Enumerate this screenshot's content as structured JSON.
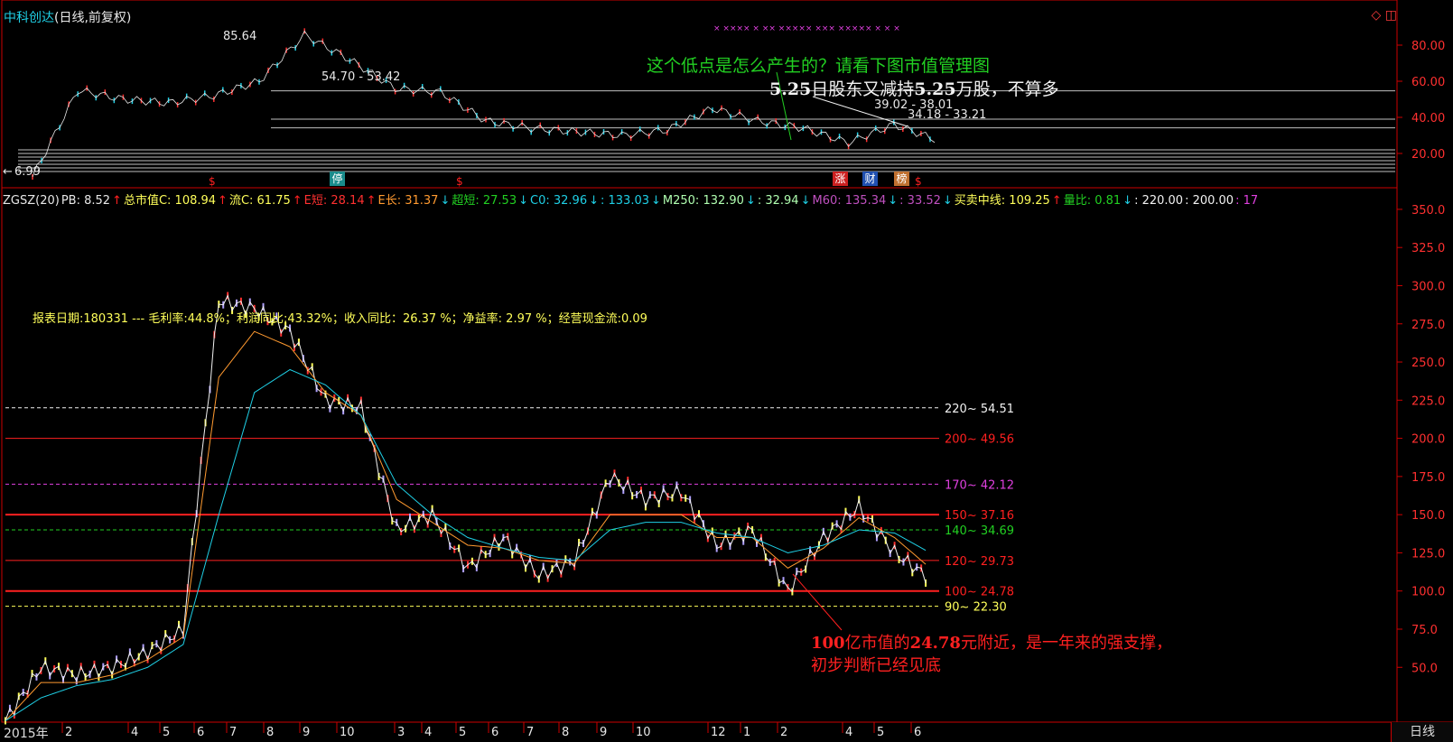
{
  "header": {
    "stock_name": "中科创达",
    "suffix": "(日线,前复权)",
    "icons": [
      "diamond-icon",
      "window-icon"
    ]
  },
  "colors": {
    "border": "#cc0000",
    "cyan": "#1fd0e6",
    "yellow": "#ffff5a",
    "green": "#22d022",
    "red": "#ff2020",
    "magenta": "#e040e0",
    "white": "#f2f2f2"
  },
  "upper_panel_labels": {
    "peak": "85.64",
    "range_left": "54.70 - 53.42",
    "range_mid": "39.02 - 38.01",
    "range_right": "34.18 - 33.21",
    "low": "6.99",
    "low_arrow": "←"
  },
  "annotations": {
    "green_question": "这个低点是怎么产生的？请看下图市值管理图",
    "white_note_prefix": "5.25",
    "white_note_mid": "日股东又减持",
    "white_note_bold": "5.25",
    "white_note_suffix": "万股，不算多",
    "red_note_line1_prefix": "100",
    "red_note_line1_mid": "亿市值的",
    "red_note_line1_bold": "24.78",
    "red_note_line1_suffix": "元附近，是一年来的强支撑，",
    "red_note_line2": "初步判断已经见底"
  },
  "badges": [
    {
      "label": "停",
      "bg": "#1a8c8c"
    },
    {
      "label": "涨",
      "bg": "#cc2020"
    },
    {
      "label": "财",
      "bg": "#2050b0"
    },
    {
      "label": "榜",
      "bg": "#c07030"
    }
  ],
  "s_markers": [
    "$",
    "$",
    "$"
  ],
  "indicator_row": [
    {
      "text": "ZGSZ(20)",
      "color": "#e8e8e8"
    },
    {
      "text": "PB: 8.52",
      "color": "#e8e8e8"
    },
    {
      "text": "↑",
      "color": "#ff2020"
    },
    {
      "text": "总市值C: 108.94",
      "color": "#ffff5a"
    },
    {
      "text": "↑",
      "color": "#ff2020"
    },
    {
      "text": "流C: 61.75",
      "color": "#ffff5a"
    },
    {
      "text": "↑",
      "color": "#ff2020"
    },
    {
      "text": "E短: 28.14",
      "color": "#ff3030"
    },
    {
      "text": "↑",
      "color": "#ff2020"
    },
    {
      "text": "E长: 31.37",
      "color": "#ff9a30"
    },
    {
      "text": "↓",
      "color": "#1fd0e6"
    },
    {
      "text": "超短: 27.53",
      "color": "#22d022"
    },
    {
      "text": "↓",
      "color": "#1fd0e6"
    },
    {
      "text": "C0: 32.96",
      "color": "#1fd0e6"
    },
    {
      "text": "↓",
      "color": "#1fd0e6"
    },
    {
      "text": ": 133.03",
      "color": "#1fd0e6"
    },
    {
      "text": "↓",
      "color": "#1fd0e6"
    },
    {
      "text": "M250: 132.90",
      "color": "#b0ffb0"
    },
    {
      "text": "↓",
      "color": "#1fd0e6"
    },
    {
      "text": ": 32.94",
      "color": "#b0ffb0"
    },
    {
      "text": "↓",
      "color": "#1fd0e6"
    },
    {
      "text": "M60: 135.34",
      "color": "#c050c0"
    },
    {
      "text": "↓",
      "color": "#1fd0e6"
    },
    {
      "text": ": 33.52",
      "color": "#c050c0"
    },
    {
      "text": "↓",
      "color": "#1fd0e6"
    },
    {
      "text": "买卖中线: 109.25",
      "color": "#ffff5a"
    },
    {
      "text": "↑",
      "color": "#ff2020"
    },
    {
      "text": "量比: 0.81",
      "color": "#22d022"
    },
    {
      "text": "↓",
      "color": "#1fd0e6"
    },
    {
      "text": ": 220.00",
      "color": "#f2f2f2"
    },
    {
      "text": ": 200.00",
      "color": "#f2f2f2"
    },
    {
      "text": ": 17",
      "color": "#e040e0"
    }
  ],
  "report_line": "报表日期:180331 --- 毛利率:44.8%；利润同比:43.32%；收入同比：26.37 %；净益率: 2.97 %；经营现金流:0.09",
  "bottom": {
    "year_label": "2015年",
    "period_tab": "日线"
  },
  "chart_data": [
    {
      "type": "line",
      "title": "中科创达(日线,前复权)",
      "yticks": [
        "80.00",
        "60.00",
        "40.00",
        "20.00"
      ],
      "ylim": [
        5,
        90
      ],
      "x": [
        0,
        5,
        10,
        15,
        20,
        25,
        30,
        35,
        40,
        45,
        50,
        55,
        60,
        65,
        70,
        75,
        80,
        85,
        90,
        95,
        100
      ],
      "values": [
        7,
        55,
        50,
        48,
        52,
        60,
        85.64,
        72,
        56,
        54,
        38,
        34,
        32,
        30,
        33,
        45,
        38,
        34,
        26,
        36,
        27
      ],
      "horizontal_levels": [
        54.7,
        39.02,
        34.18,
        22,
        20,
        18,
        16,
        14,
        12,
        10
      ]
    },
    {
      "type": "line",
      "title": "ZGSZ(20)",
      "yticks": [
        "350.0",
        "325.0",
        "300.0",
        "275.0",
        "250.0",
        "225.0",
        "200.0",
        "175.0",
        "150.0",
        "125.0",
        "100.0",
        "75.0",
        "50.0"
      ],
      "ylim": [
        20,
        360
      ],
      "xticks": [
        "2015年",
        "2",
        "4",
        "5",
        "6",
        "7",
        "8",
        "9",
        "10",
        "3",
        "4",
        "5",
        "6",
        "7",
        "8",
        "9",
        "10",
        "12",
        "1",
        "2",
        "4",
        "5",
        "6"
      ],
      "series": [
        {
          "values": [
            15,
            50,
            45,
            50,
            60,
            75,
            290,
            285,
            270,
            225,
            220,
            140,
            150,
            115,
            135,
            110,
            120,
            175,
            160,
            165,
            130,
            140,
            100,
            135,
            155,
            125,
            108
          ]
        },
        {
          "values": [
            15,
            40,
            40,
            45,
            55,
            70,
            240,
            270,
            260,
            230,
            215,
            160,
            145,
            130,
            128,
            120,
            118,
            150,
            150,
            150,
            135,
            135,
            115,
            128,
            148,
            135,
            115
          ]
        },
        {
          "values": [
            15,
            30,
            38,
            42,
            50,
            65,
            150,
            230,
            245,
            235,
            215,
            170,
            150,
            135,
            128,
            122,
            120,
            140,
            145,
            145,
            138,
            135,
            125,
            130,
            140,
            138,
            125
          ]
        }
      ],
      "levels": [
        {
          "value": 220,
          "label": "220~ 54.51",
          "color": "#f2f2f2",
          "dash": true
        },
        {
          "value": 200,
          "label": "200~ 49.56",
          "color": "#ff2020",
          "dash": false
        },
        {
          "value": 170,
          "label": "170~ 42.12",
          "color": "#e040e0",
          "dash": true
        },
        {
          "value": 150,
          "label": "150~ 37.16",
          "color": "#ff2020",
          "dash": false
        },
        {
          "value": 140,
          "label": "140~ 34.69",
          "color": "#22d022",
          "dash": true
        },
        {
          "value": 120,
          "label": "120~ 29.73",
          "color": "#ff2020",
          "dash": false
        },
        {
          "value": 100,
          "label": "100~ 24.78",
          "color": "#ff2020",
          "dash": false
        },
        {
          "value": 90,
          "label": "90~ 22.30",
          "color": "#ffff5a",
          "dash": true
        }
      ]
    }
  ]
}
